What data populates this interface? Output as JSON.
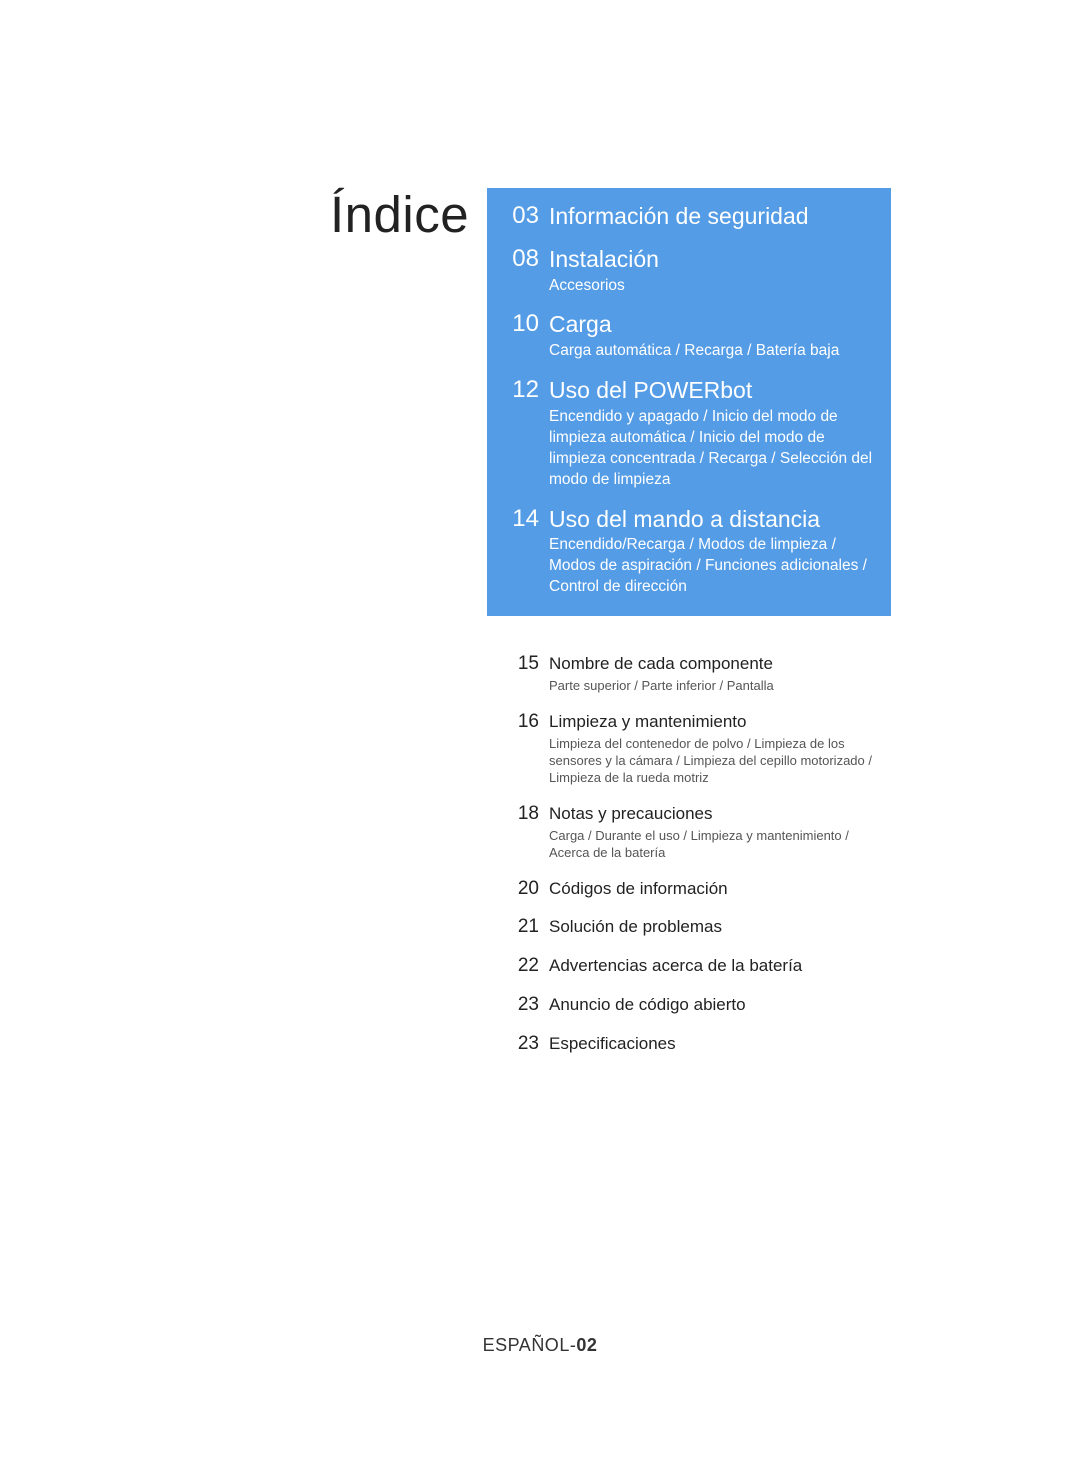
{
  "title": "Índice",
  "blue_entries": [
    {
      "page": "03",
      "title": "Información de seguridad"
    },
    {
      "page": "08",
      "title": "Instalación",
      "sub": "Accesorios"
    },
    {
      "page": "10",
      "title": "Carga",
      "sub": "Carga automática / Recarga / Batería baja"
    },
    {
      "page": "12",
      "title": "Uso del POWERbot",
      "sub": "Encendido y apagado / Inicio del modo de limpieza automática / Inicio del modo de limpieza concentrada / Recarga / Selección del modo de limpieza"
    },
    {
      "page": "14",
      "title": "Uso del mando a distancia",
      "sub": "Encendido/Recarga / Modos de limpieza / Modos de aspiración / Funciones adicionales / Control de dirección"
    }
  ],
  "white_entries": [
    {
      "page": "15",
      "title": "Nombre de cada componente",
      "sub": "Parte superior / Parte inferior / Pantalla"
    },
    {
      "page": "16",
      "title": "Limpieza y mantenimiento",
      "sub": "Limpieza del contenedor de polvo / Limpieza de los sensores y la cámara / Limpieza del cepillo motorizado / Limpieza de la rueda motriz"
    },
    {
      "page": "18",
      "title": "Notas y precauciones",
      "sub": "Carga / Durante el uso / Limpieza y mantenimiento / Acerca de la batería"
    },
    {
      "page": "20",
      "title": "Códigos de información"
    },
    {
      "page": "21",
      "title": "Solución de problemas"
    },
    {
      "page": "22",
      "title": "Advertencias acerca de la batería"
    },
    {
      "page": "23",
      "title": "Anuncio de código abierto"
    },
    {
      "page": "23",
      "title": "Especificaciones"
    }
  ],
  "footer": {
    "lang": "ESPAÑOL-",
    "page": "02"
  }
}
